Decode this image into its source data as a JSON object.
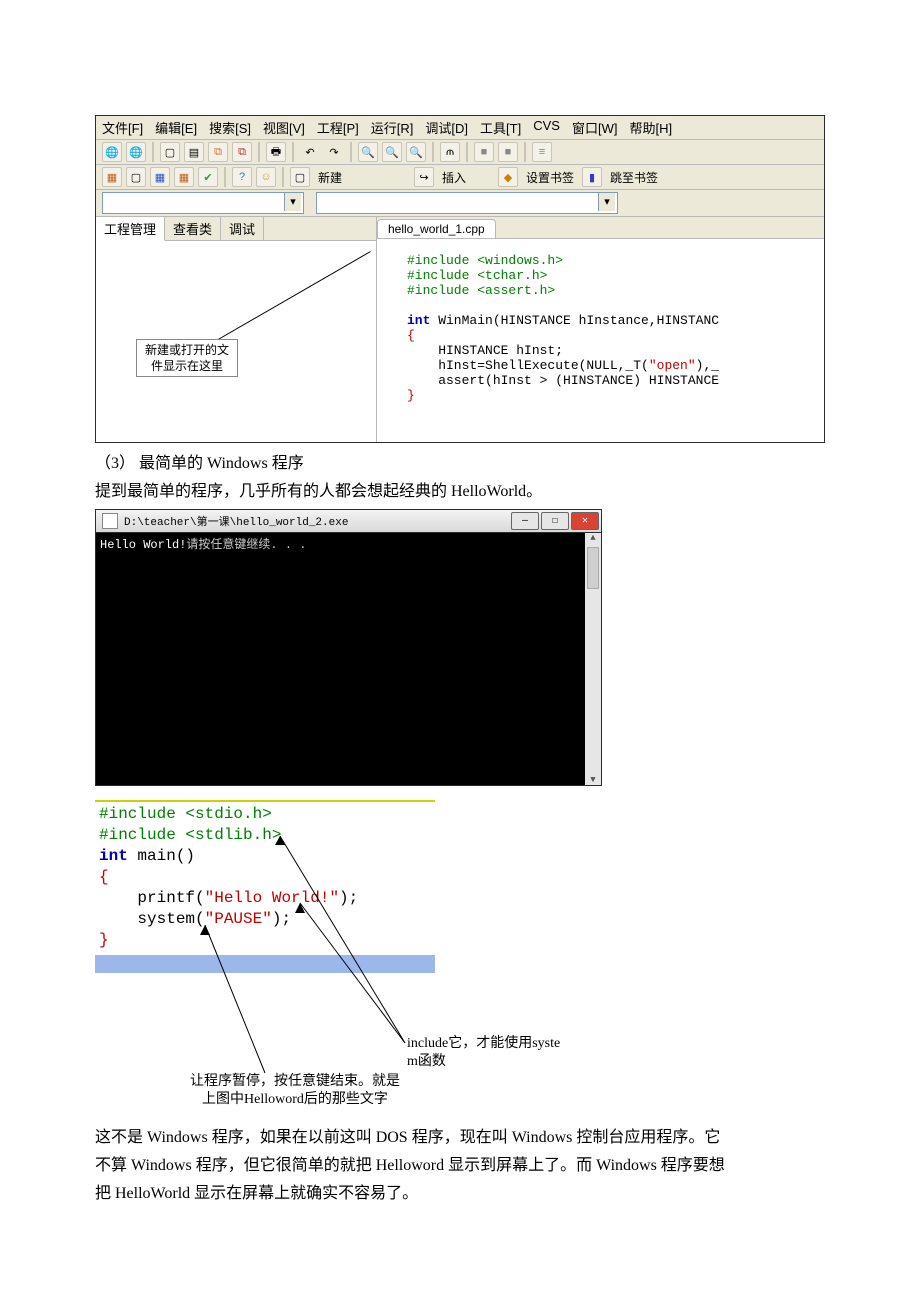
{
  "ide": {
    "menu": {
      "file": "文件[F]",
      "edit": "编辑[E]",
      "search": "搜索[S]",
      "view": "视图[V]",
      "project": "工程[P]",
      "run": "运行[R]",
      "debug": "调试[D]",
      "tools": "工具[T]",
      "cvs": "CVS",
      "window": "窗口[W]",
      "help": "帮助[H]"
    },
    "toolbar2": {
      "new": "新建",
      "insert": "插入",
      "setbm": "设置书签",
      "gotobm": "跳至书签"
    },
    "side_tabs": {
      "proj": "工程管理",
      "clsview": "查看类",
      "debug": "调试"
    },
    "side_callout_l1": "新建或打开的文",
    "side_callout_l2": "件显示在这里",
    "editor_tab": "hello_world_1.cpp",
    "code": {
      "l1a": "#include ",
      "l1b": "<windows.h>",
      "l2a": "#include ",
      "l2b": "<tchar.h>",
      "l3a": "#include ",
      "l3b": "<assert.h>",
      "l5a": "int",
      "l5b": " WinMain(HINSTANCE hInstance,HINSTANC",
      "l6": "{",
      "l7": "    HINSTANCE hInst;",
      "l8a": "    hInst=ShellExecute(NULL,_T(",
      "l8b": "\"open\"",
      "l8c": "),_",
      "l9a": "    assert(hInst > (HINSTANCE) HINSTANCE",
      "l10": "}"
    }
  },
  "text": {
    "heading3": "（3） 最简单的 Windows 程序",
    "p1": "提到最简单的程序，几乎所有的人都会想起经典的 HelloWorld。",
    "p2_a": "这不是 Windows 程序，如果在以前这叫 DOS 程序，现在叫 Windows 控制台应用程序。它",
    "p2_b": "不算 Windows 程序，但它很简单的就把 Helloword 显示到屏幕上了。而 Windows 程序要想",
    "p2_c": "把 HelloWorld 显示在屏幕上就确实不容易了。"
  },
  "console": {
    "title_path": "D:\\teacher\\第一课\\hello_world_2.exe",
    "line1_a": "Hello World!",
    "line1_b": "请按任意键继续. . ."
  },
  "code2": {
    "l1a": "#include ",
    "l1b": "<stdio.h>",
    "l2a": "#include ",
    "l2b": "<stdlib.h>",
    "l3a": "int",
    "l3b": " main()",
    "l4": "{",
    "l5a": "    printf(",
    "l5b": "\"Hello World!\"",
    "l5c": ");",
    "l6a": "    system(",
    "l6b": "\"PAUSE\"",
    "l6c": ");",
    "l7": "}"
  },
  "annotations": {
    "right_l1": "include它，才能使用syste",
    "right_l2": "m函数",
    "bottom_l1": "让程序暂停，按任意键结束。就是",
    "bottom_l2": "上图中Helloword后的那些文字"
  }
}
